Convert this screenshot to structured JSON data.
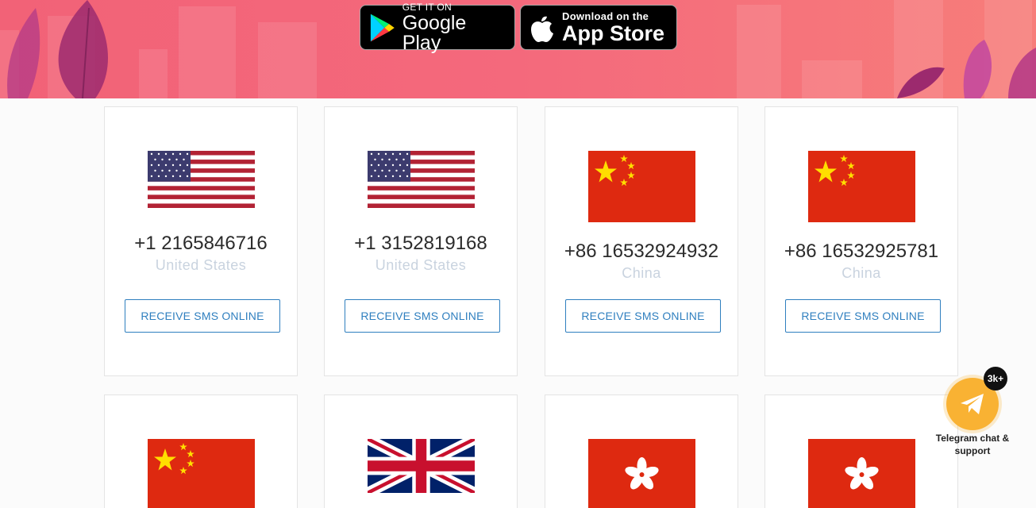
{
  "header": {
    "google_play": {
      "small": "GET IT ON",
      "big": "Google Play",
      "icon": "google-play-icon"
    },
    "app_store": {
      "small": "Download on the",
      "big": "App Store",
      "icon": "apple-icon"
    }
  },
  "cards": [
    {
      "number": "+1 2165846716",
      "country": "United States",
      "flag": "us",
      "button": "RECEIVE SMS ONLINE"
    },
    {
      "number": "+1 3152819168",
      "country": "United States",
      "flag": "us",
      "button": "RECEIVE SMS ONLINE"
    },
    {
      "number": "+86 16532924932",
      "country": "China",
      "flag": "cn",
      "button": "RECEIVE SMS ONLINE"
    },
    {
      "number": "+86 16532925781",
      "country": "China",
      "flag": "cn",
      "button": "RECEIVE SMS ONLINE"
    },
    {
      "flag": "cn"
    },
    {
      "flag": "gb"
    },
    {
      "flag": "hk"
    },
    {
      "flag": "hk"
    }
  ],
  "telegram": {
    "badge": "3k+",
    "label": "Telegram chat & support",
    "icon": "telegram-icon",
    "color": "#f9b233"
  },
  "colors": {
    "accent": "#2f7fbf",
    "hero": "#f26277"
  }
}
